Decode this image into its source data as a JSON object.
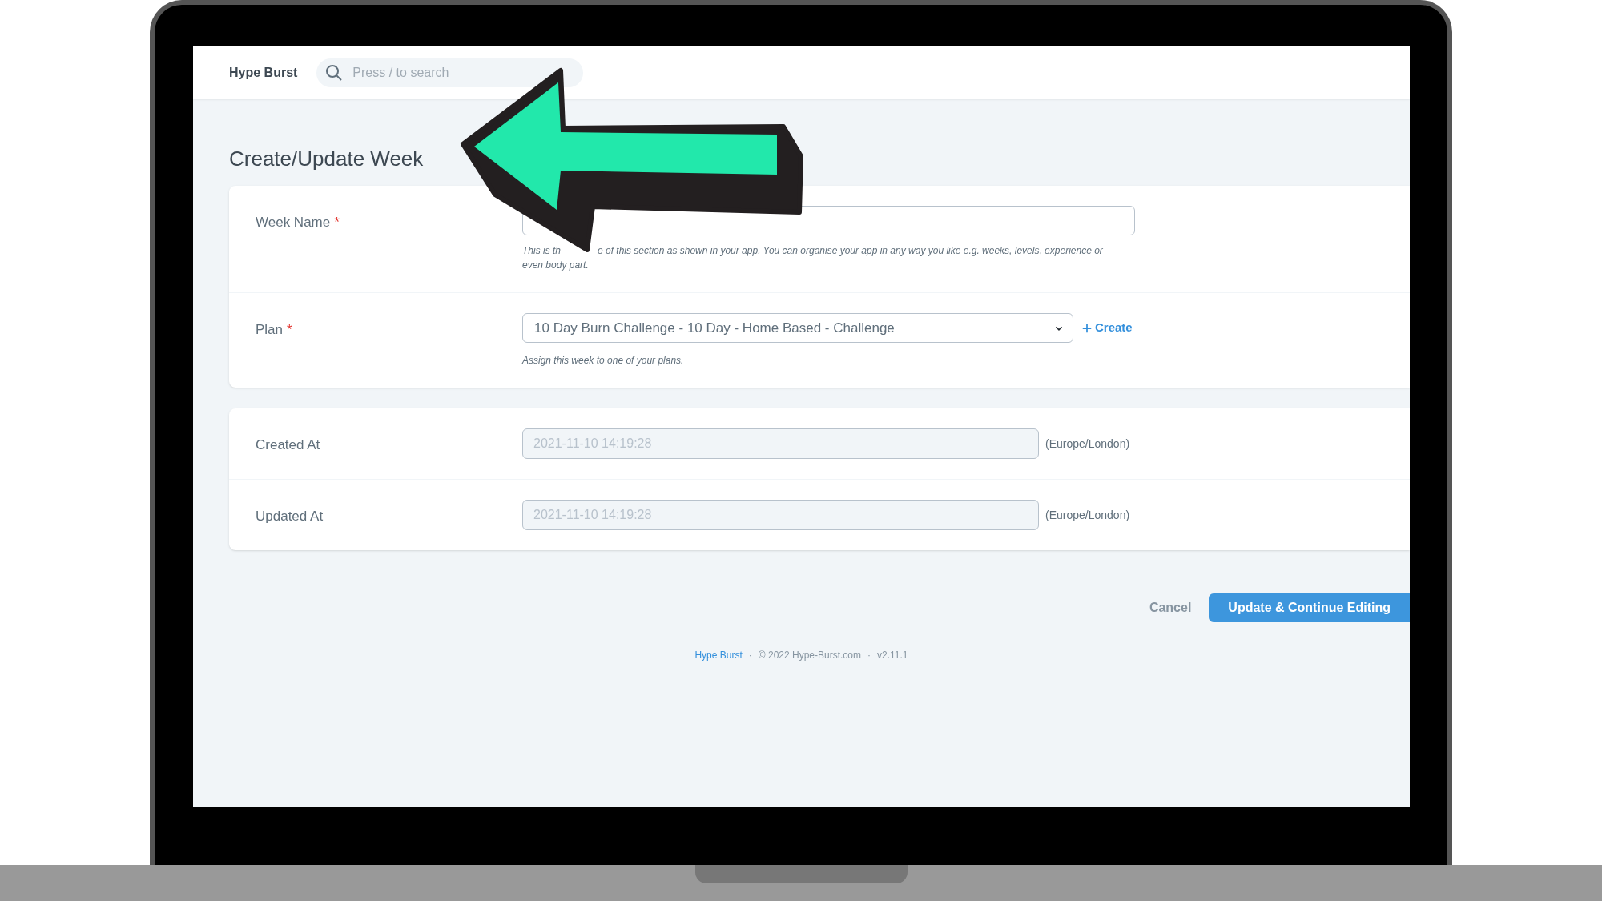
{
  "header": {
    "brand": "Hype Burst",
    "search": {
      "placeholder": "Press / to search"
    }
  },
  "page_title": "Create/Update Week",
  "sections": [
    {
      "fields": [
        {
          "kind": "text",
          "label": "Week Name",
          "required": true,
          "required_mark": "*",
          "help": [
            "This is th",
            "e of this section as shown in your app. You can organise your app in any way you like e.g. weeks, levels, experience or",
            "even body part."
          ]
        },
        {
          "kind": "select",
          "label": "Plan",
          "required": true,
          "required_mark": "*",
          "value": "10 Day Burn Challenge - 10 Day - Home Based - Challenge",
          "action": "Create",
          "help": [
            "Assign this week to one of your plans."
          ]
        }
      ]
    },
    {
      "fields": [
        {
          "kind": "datetime",
          "label": "Created At",
          "value": "2021-11-10 14:19:28",
          "disabled": true,
          "suffix": "(Europe/London)"
        },
        {
          "kind": "datetime",
          "label": "Updated At",
          "value": "2021-11-10 14:19:28",
          "disabled": true,
          "suffix": "(Europe/London)"
        }
      ]
    }
  ],
  "actions": [
    {
      "kind": "secondary",
      "label": "Cancel"
    },
    {
      "kind": "primary",
      "label": "Update & Continue Editing"
    }
  ],
  "footer": {
    "separator": "·",
    "items": [
      {
        "kind": "link",
        "text": "Hype Burst"
      },
      {
        "kind": "text",
        "text": "© 2022 Hype-Burst.com"
      },
      {
        "kind": "text",
        "text": "v2.11.1"
      }
    ]
  }
}
